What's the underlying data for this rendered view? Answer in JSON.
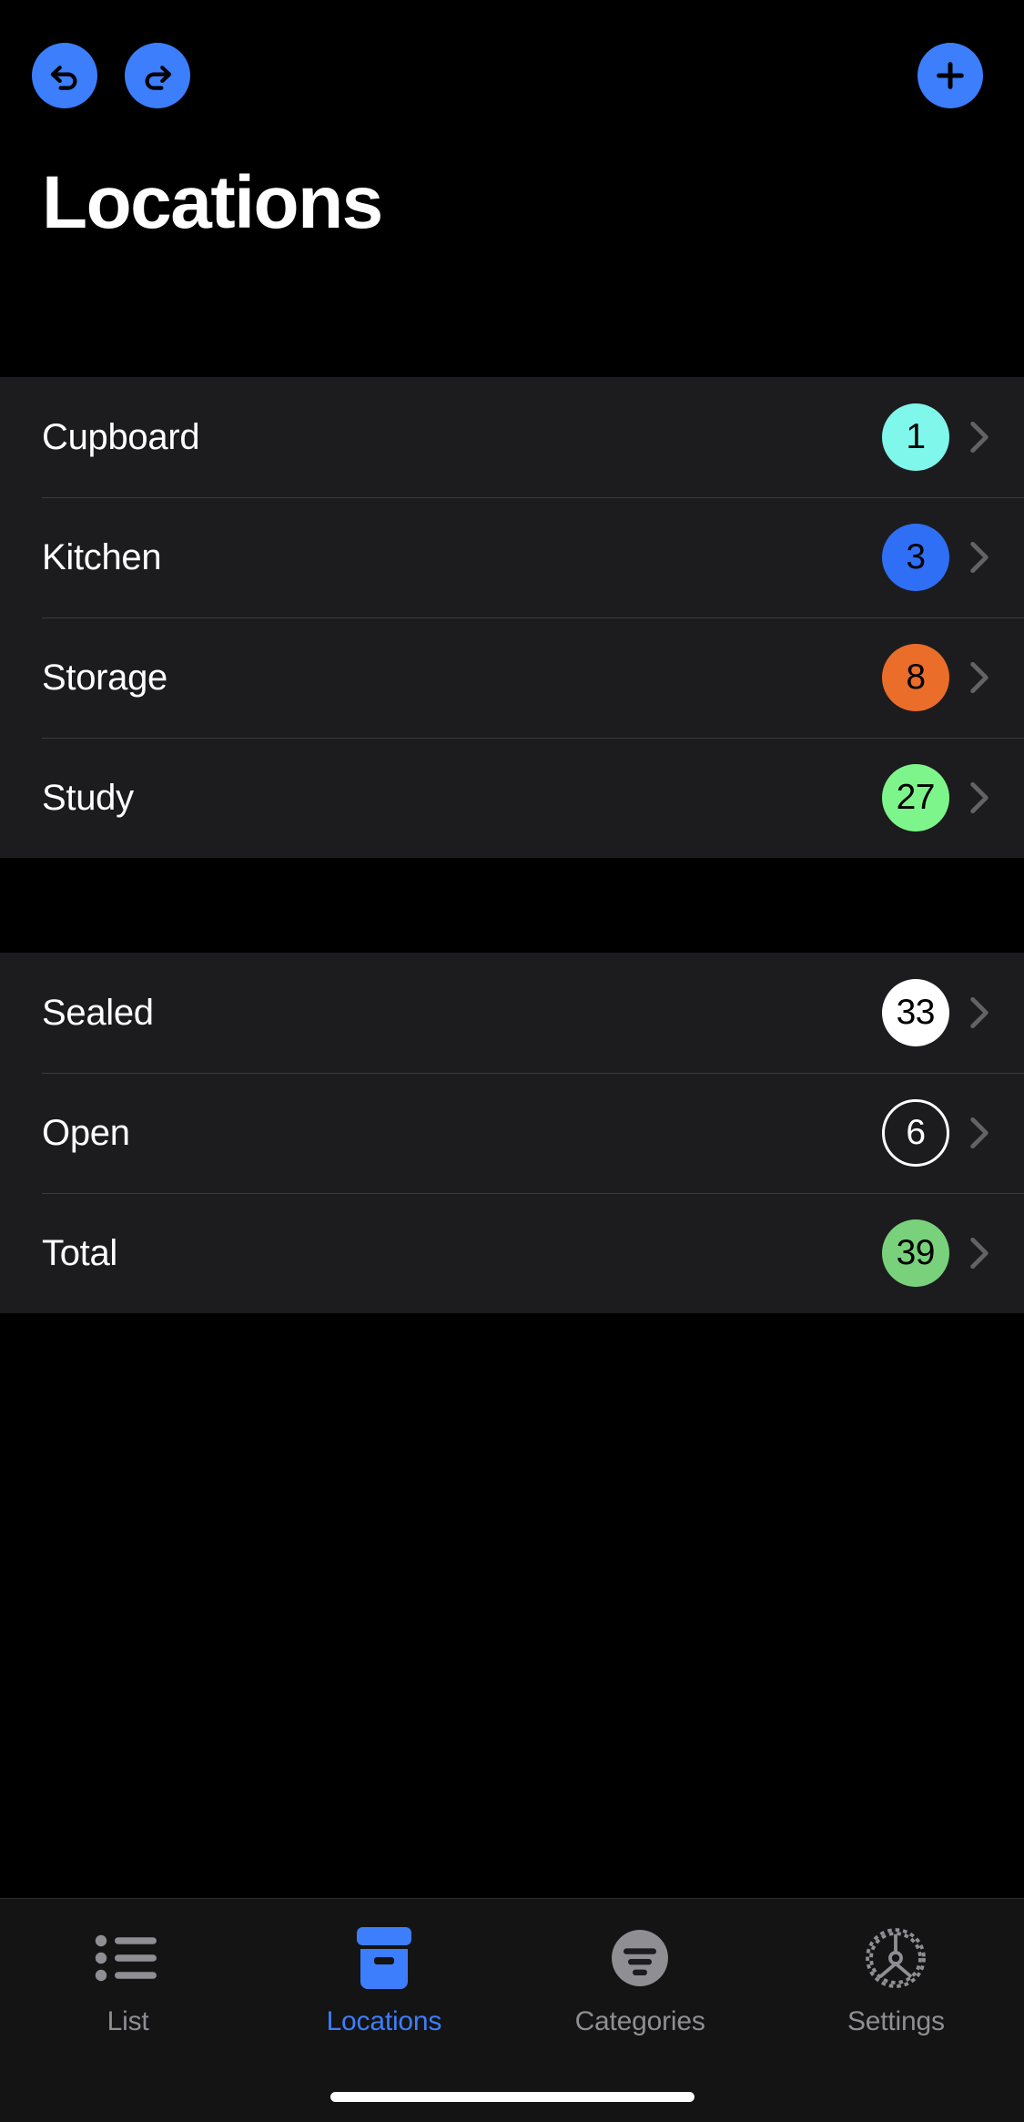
{
  "header": {
    "title": "Locations",
    "undo_label": "Undo",
    "redo_label": "Redo",
    "add_label": "Add",
    "accent_color": "#3d7efc"
  },
  "sections": [
    {
      "name": "locations",
      "rows": [
        {
          "label": "Cupboard",
          "count": "1",
          "badge_color": "#7ff7ea",
          "style": "filled"
        },
        {
          "label": "Kitchen",
          "count": "3",
          "badge_color": "#2f6ff5",
          "style": "filled"
        },
        {
          "label": "Storage",
          "count": "8",
          "badge_color": "#ea6d2a",
          "style": "filled"
        },
        {
          "label": "Study",
          "count": "27",
          "badge_color": "#7ef58a",
          "style": "filled"
        }
      ]
    },
    {
      "name": "summary",
      "rows": [
        {
          "label": "Sealed",
          "count": "33",
          "badge_color": "#ffffff",
          "style": "filled"
        },
        {
          "label": "Open",
          "count": "6",
          "badge_color": "#ffffff",
          "style": "outlined"
        },
        {
          "label": "Total",
          "count": "39",
          "badge_color": "#79d17c",
          "style": "filled"
        }
      ]
    }
  ],
  "tabbar": {
    "tabs": [
      {
        "label": "List",
        "icon": "bullet-list-icon",
        "active": false
      },
      {
        "label": "Locations",
        "icon": "archive-box-icon",
        "active": true
      },
      {
        "label": "Categories",
        "icon": "filter-circle-icon",
        "active": false
      },
      {
        "label": "Settings",
        "icon": "gear-icon",
        "active": false
      }
    ]
  }
}
